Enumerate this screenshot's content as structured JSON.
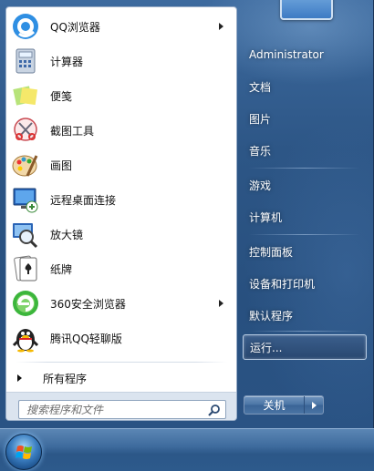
{
  "programs": [
    {
      "label": "QQ浏览器",
      "icon": "qq-browser-icon",
      "has_submenu": true
    },
    {
      "label": "计算器",
      "icon": "calculator-icon",
      "has_submenu": false
    },
    {
      "label": "便笺",
      "icon": "sticky-notes-icon",
      "has_submenu": false
    },
    {
      "label": "截图工具",
      "icon": "snipping-tool-icon",
      "has_submenu": false
    },
    {
      "label": "画图",
      "icon": "paint-icon",
      "has_submenu": false
    },
    {
      "label": "远程桌面连接",
      "icon": "remote-desktop-icon",
      "has_submenu": false
    },
    {
      "label": "放大镜",
      "icon": "magnifier-icon",
      "has_submenu": false
    },
    {
      "label": "纸牌",
      "icon": "solitaire-icon",
      "has_submenu": false
    },
    {
      "label": "360安全浏览器",
      "icon": "360-browser-icon",
      "has_submenu": true
    },
    {
      "label": "腾讯QQ轻聊版",
      "icon": "qq-penguin-icon",
      "has_submenu": false
    }
  ],
  "all_programs_label": "所有程序",
  "search": {
    "placeholder": "搜索程序和文件"
  },
  "right_links": {
    "user": "Administrator",
    "documents": "文档",
    "pictures": "图片",
    "music": "音乐",
    "games": "游戏",
    "computer": "计算机",
    "control_panel": "控制面板",
    "devices_printers": "设备和打印机",
    "default_programs": "默认程序",
    "run": "运行..."
  },
  "shutdown_label": "关机",
  "colors": {
    "frame": "#2d5686",
    "highlight_border": "#b8cde4",
    "taskbar": "#3f6c9e"
  }
}
